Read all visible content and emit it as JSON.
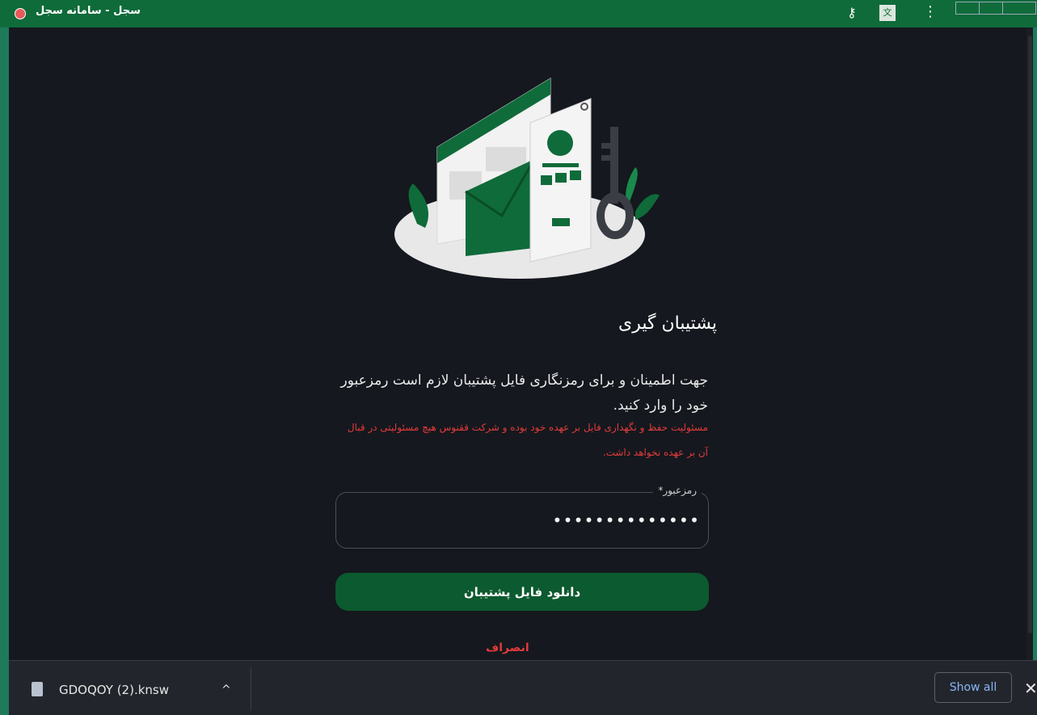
{
  "window": {
    "title": "سجل - سامانه سجل",
    "controls": [
      "minimize-icon",
      "maximize-icon",
      "close-icon"
    ],
    "toolbar_icons": [
      "key-icon",
      "translate-icon",
      "menu-icon"
    ]
  },
  "page": {
    "illustration": "security-illustration",
    "heading": "پشتیبان گیری",
    "description": "جهت اطمینان و برای رمزنگاری فایل پشتیبان لازم است رمزعبور خود را وارد کنید.",
    "warning": "مسئولیت حفظ و نگهداری فایل بر عهده خود بوده و شرکت ققنوس هیچ مسئولیتی در قبال آن بر عهده نخواهد داشت.",
    "password_label": "رمزعبور",
    "password_required_mark": "*",
    "password_value": "••••••••••••••",
    "download_button": "دانلود فایل پشتیبان",
    "cancel_link": "انصراف"
  },
  "download_bar": {
    "file_name": "GDOQOY (2).knsw",
    "show_all": "Show all"
  },
  "colors": {
    "brand_green": "#0c5a2f",
    "titlebar_green": "#0f6b3a",
    "warning_red": "#e23b3b",
    "background": "#15181e",
    "link_blue": "#8ab4f8"
  }
}
